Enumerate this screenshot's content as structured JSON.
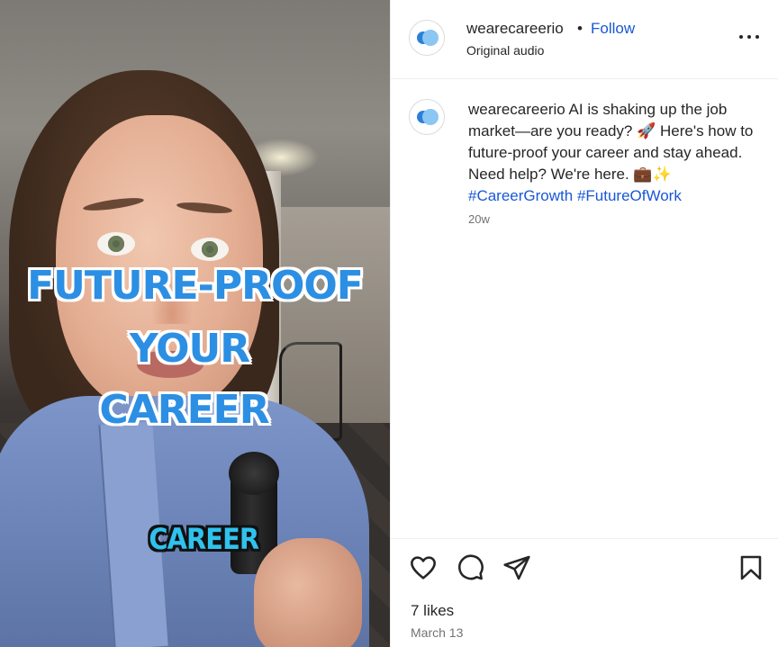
{
  "media": {
    "overlay_lines": [
      "FUTURE-PROOF",
      "YOUR",
      "CAREER"
    ],
    "caption_word": "CAREER",
    "colors": {
      "overlay_text": "#2c8fe3",
      "caption_chip": "#2fc2ee"
    }
  },
  "header": {
    "username": "wearecareerio",
    "separator": "•",
    "follow_label": "Follow",
    "subtitle": "Original audio",
    "more_icon": "more-horizontal-icon"
  },
  "caption": {
    "username": "wearecareerio",
    "text": "AI is shaking up the job market—are you ready? 🚀 Here's how to future-proof your career and stay ahead. Need help? We're here. 💼✨",
    "hashtags": [
      "#CareerGrowth",
      "#FutureOfWork"
    ],
    "time": "20w"
  },
  "actions": {
    "icons": [
      "heart-icon",
      "comment-icon",
      "share-icon",
      "bookmark-icon"
    ],
    "likes": "7 likes",
    "date": "March 13"
  },
  "colors": {
    "link": "#1a57d6",
    "text": "#262626",
    "muted": "#737373"
  }
}
